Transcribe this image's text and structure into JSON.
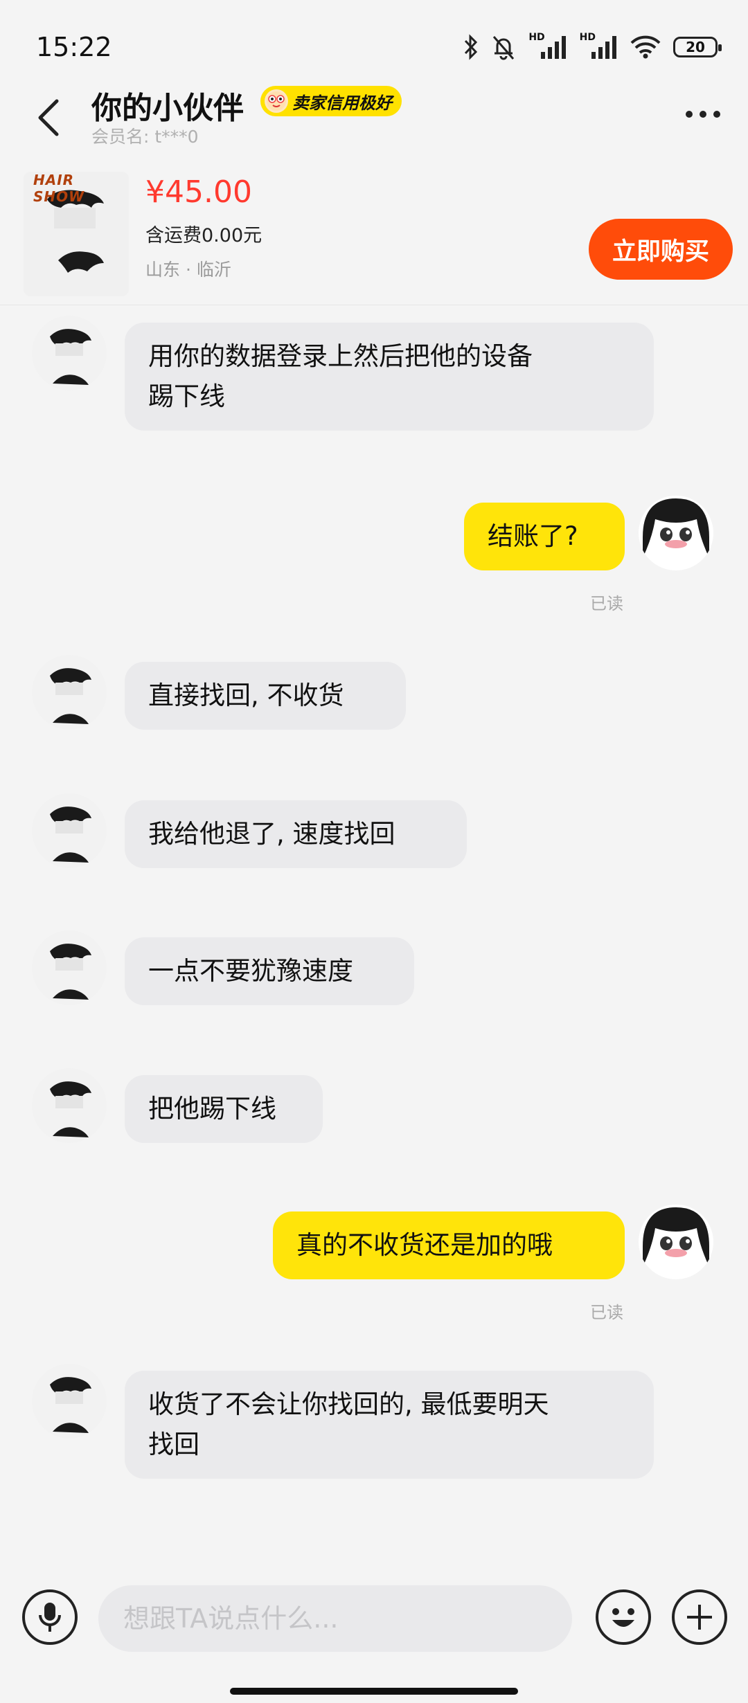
{
  "status_bar": {
    "time": "15:22",
    "hd_label": "HD",
    "battery": "20"
  },
  "header": {
    "title": "你的小伙伴",
    "badge": "卖家信用极好",
    "member_label": "会员名: t***0"
  },
  "product": {
    "thumb_brand": "HAIR SHOW",
    "price": "¥45.00",
    "shipping": "含运费0.00元",
    "location": "山东 · 临沂",
    "buy_label": "立即购买"
  },
  "messages": [
    {
      "from": "seller",
      "lines": [
        "用你的数据登录上然后把他的设备",
        "踢下线"
      ]
    },
    {
      "from": "me",
      "text": "结账了?",
      "status": "已读"
    },
    {
      "from": "seller",
      "text": "直接找回, 不收货"
    },
    {
      "from": "seller",
      "text": "我给他退了, 速度找回"
    },
    {
      "from": "seller",
      "text": "一点不要犹豫速度"
    },
    {
      "from": "seller",
      "text": "把他踢下线"
    },
    {
      "from": "me",
      "text": "真的不收货还是加的哦",
      "status": "已读"
    },
    {
      "from": "seller",
      "lines": [
        "收货了不会让你找回的, 最低要明天",
        "找回"
      ]
    }
  ],
  "input": {
    "placeholder": "想跟TA说点什么..."
  },
  "icons": {
    "back": "back-arrow-icon",
    "more": "more-dots-icon",
    "mic": "microphone-icon",
    "emoji": "emoji-icon",
    "plus": "plus-icon"
  },
  "colors": {
    "price": "#ff3a2f",
    "buy_button": "#ff4c0a",
    "badge": "#ffe100",
    "outgoing_bubble": "#ffe40a",
    "incoming_bubble": "#eaeaec"
  }
}
